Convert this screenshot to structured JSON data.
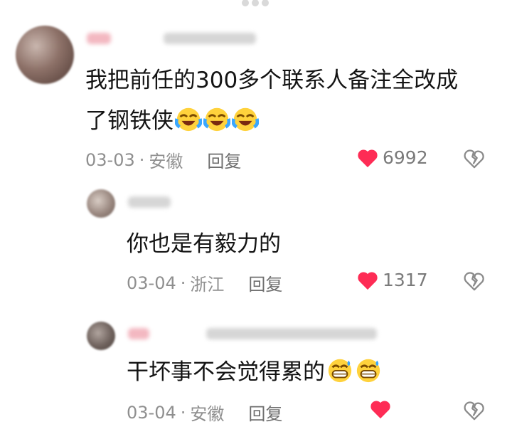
{
  "comments": [
    {
      "text": "我把前任的300多个联系人备注全改成",
      "text2": "了钢铁侠",
      "emojis": [
        "crying-laughing-emoji",
        "crying-laughing-emoji",
        "crying-laughing-emoji"
      ],
      "date": "03-03",
      "location": "安徽",
      "reply_label": "回复",
      "likes": "6992",
      "liked": true
    },
    {
      "text": "你也是有毅力的",
      "date": "03-04",
      "location": "浙江",
      "reply_label": "回复",
      "likes": "1317",
      "liked": true
    },
    {
      "text": "干坏事不会觉得累的",
      "emojis": [
        "grinning-sweat-emoji",
        "grinning-sweat-emoji"
      ],
      "date": "03-04",
      "location": "安徽",
      "reply_label": "回复",
      "liked": true
    }
  ],
  "colors": {
    "heart": "#fe2c55",
    "meta": "#8f8f8f",
    "text": "#141414"
  }
}
